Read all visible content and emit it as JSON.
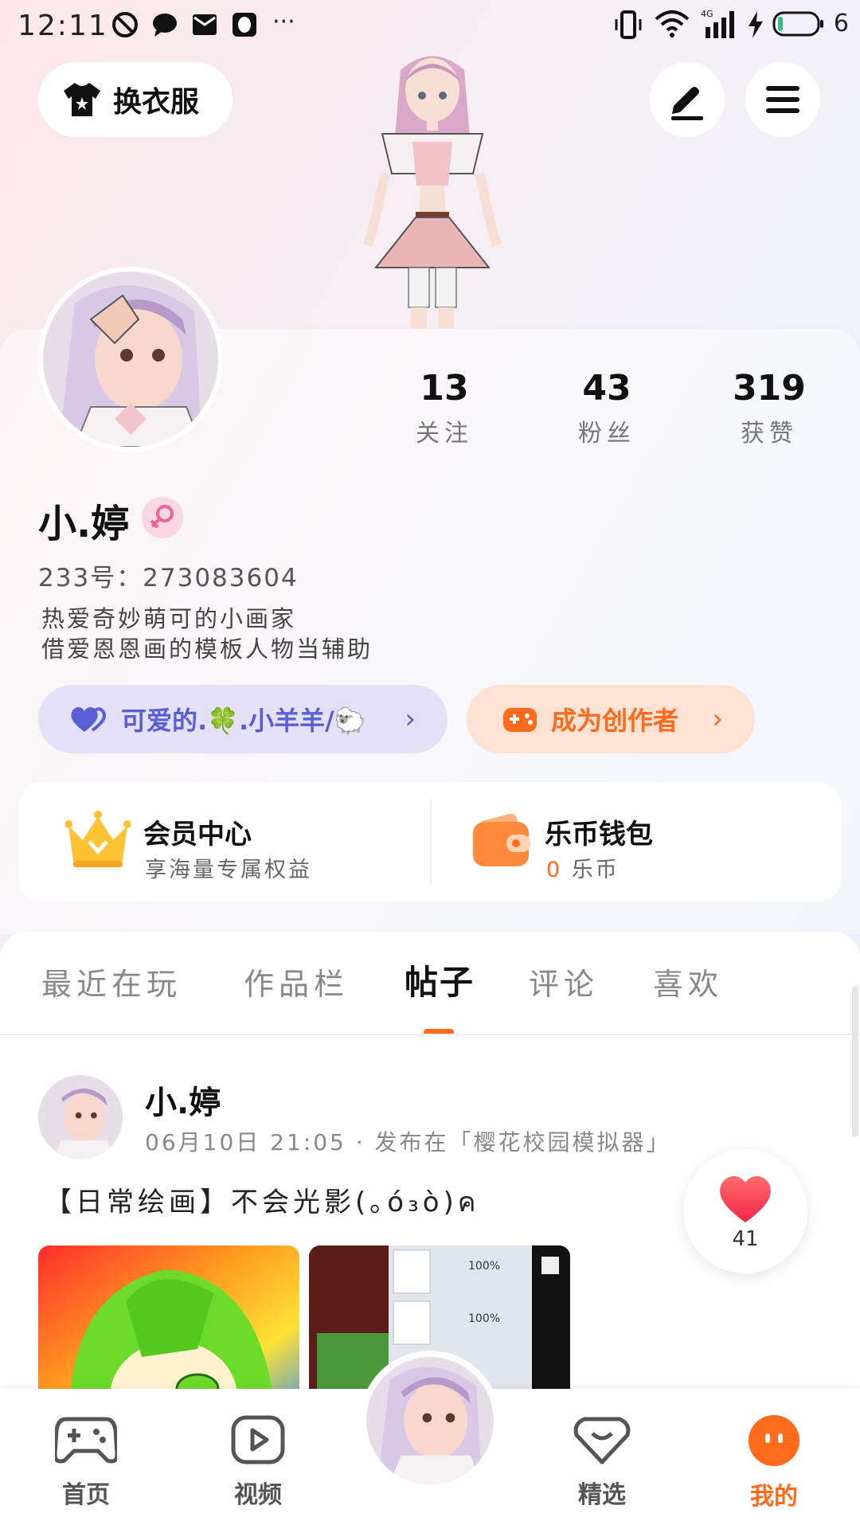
{
  "status_bar": {
    "time": "12:11",
    "battery": "6"
  },
  "top": {
    "dress_label": "换衣服"
  },
  "profile": {
    "stats": [
      {
        "num": "13",
        "label": "关注"
      },
      {
        "num": "43",
        "label": "粉丝"
      },
      {
        "num": "319",
        "label": "获赞"
      }
    ],
    "name": "小.婷",
    "uid": "233号：273083604",
    "bio_line1": "热爱奇妙萌可的小画家",
    "bio_line2": "借爱恩恩画的模板人物当辅助",
    "guild": "可爱的.🍀.小羊羊/🐑",
    "creator": "成为创作者"
  },
  "cards": {
    "member_title": "会员中心",
    "member_sub": "享海量专属权益",
    "wallet_title": "乐币钱包",
    "wallet_amount": "0",
    "wallet_unit": "乐币"
  },
  "tabs": [
    "最近在玩",
    "作品栏",
    "帖子",
    "评论",
    "喜欢"
  ],
  "post": {
    "author": "小.婷",
    "meta": "06月10日 21:05 · 发布在「樱花校园模拟器」",
    "text": "【日常绘画】不会光影(｡ó₃ò)ค",
    "likes": "41"
  },
  "nav": [
    {
      "label": "首页"
    },
    {
      "label": "视频"
    },
    {
      "label": "精选"
    },
    {
      "label": "我的"
    }
  ],
  "colors": {
    "accent": "#ff6a1b",
    "guild": "#5a5fd6",
    "gender": "#f06292"
  }
}
